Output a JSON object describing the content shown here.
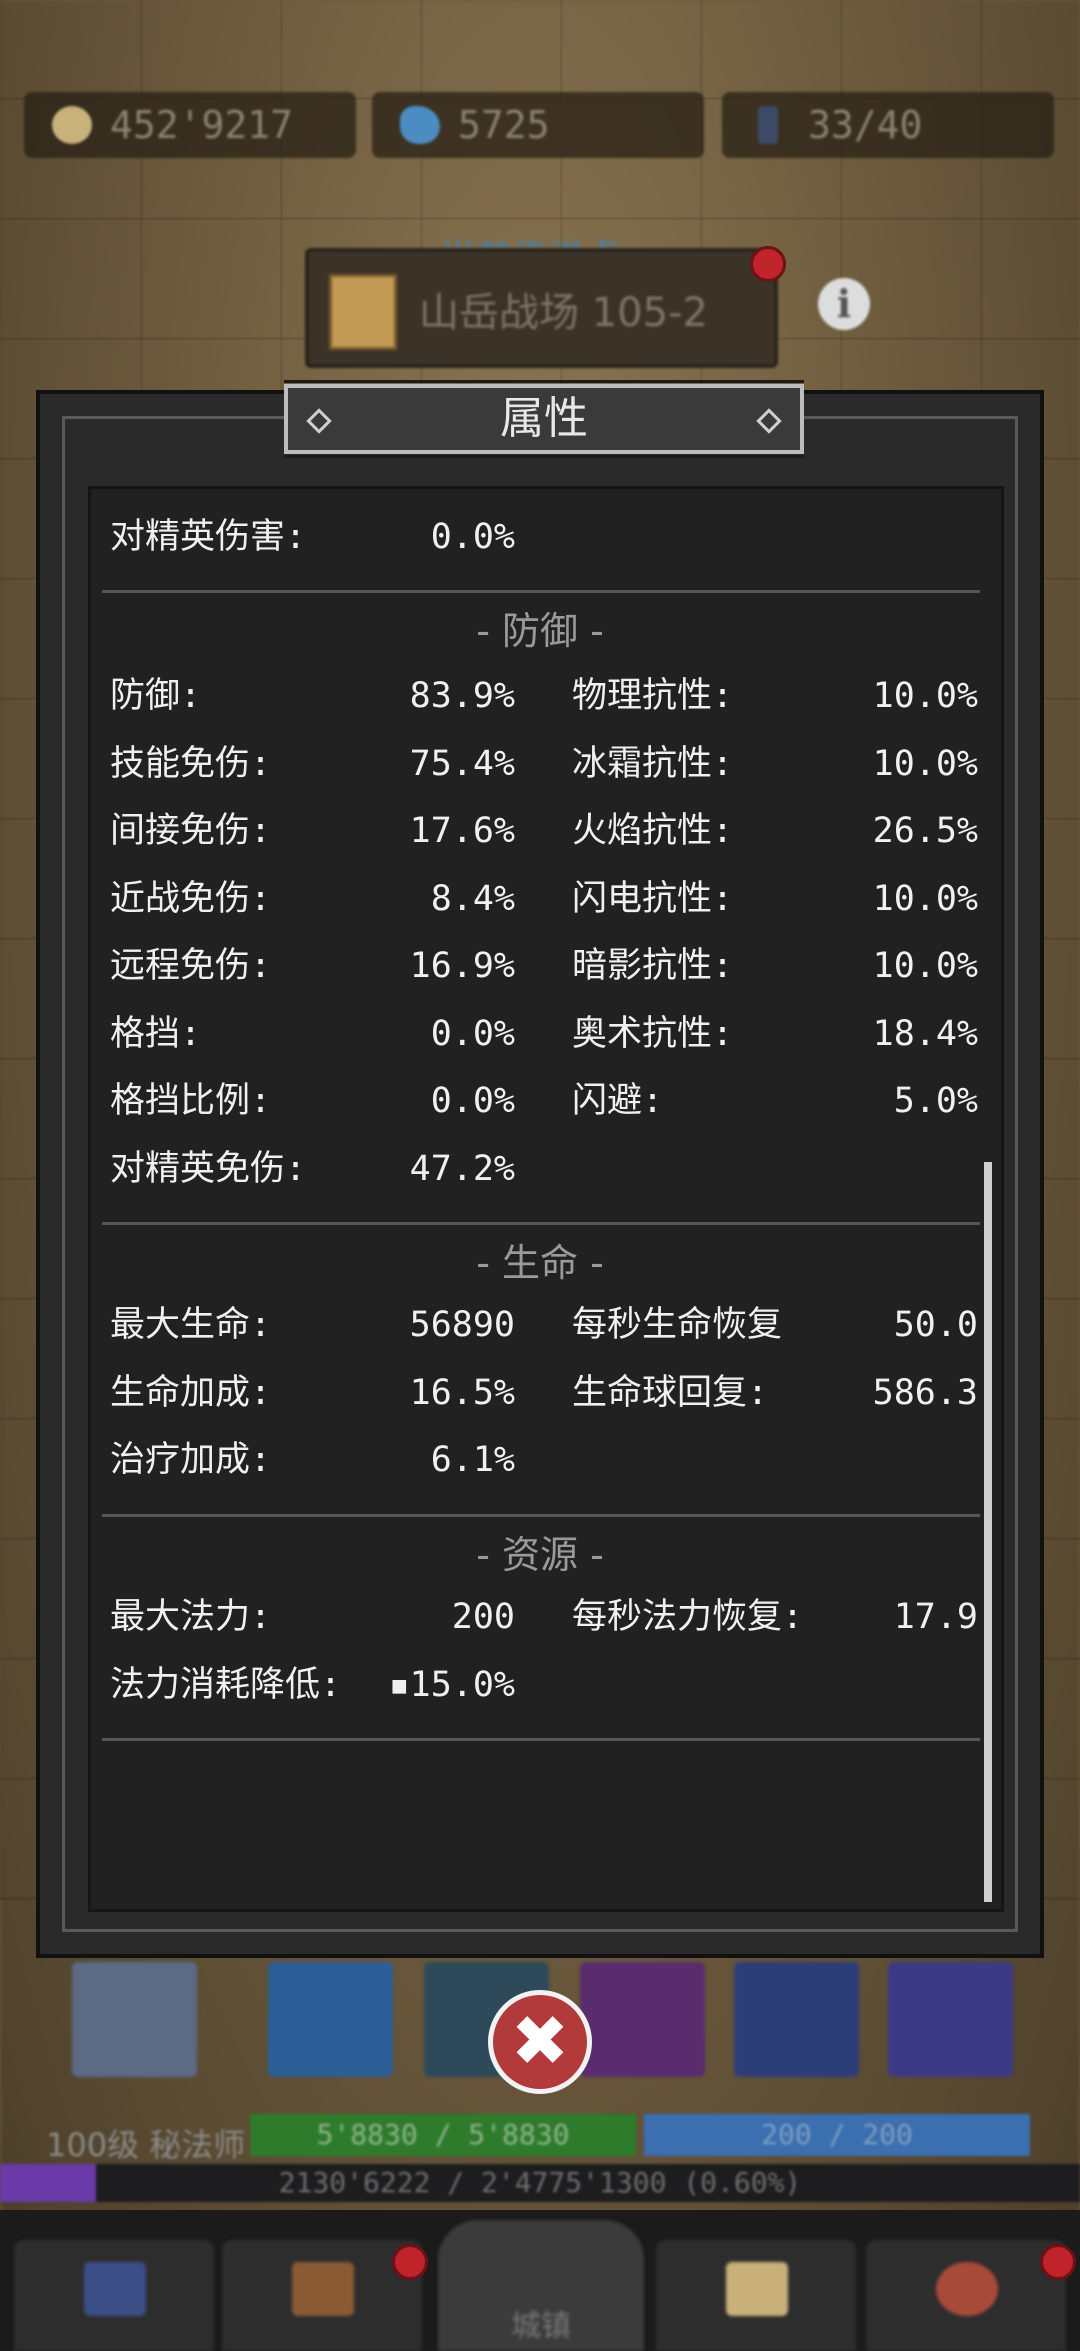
{
  "top_bar": {
    "gold": "452'9217",
    "gems": "5725",
    "keys": "33/40"
  },
  "teleport": {
    "label": "当前传送点",
    "name": "山岳战场 105-2"
  },
  "dialog": {
    "title": "属性",
    "top_rows": [
      {
        "label": "对精英伤害:",
        "value": "0.0%"
      }
    ],
    "sections": [
      {
        "title": "- 防御 -",
        "rows": [
          {
            "left_label": "防御:",
            "left_value": "83.9%",
            "right_label": "物理抗性:",
            "right_value": "10.0%"
          },
          {
            "left_label": "技能免伤:",
            "left_value": "75.4%",
            "right_label": "冰霜抗性:",
            "right_value": "10.0%"
          },
          {
            "left_label": "间接免伤:",
            "left_value": "17.6%",
            "right_label": "火焰抗性:",
            "right_value": "26.5%"
          },
          {
            "left_label": "近战免伤:",
            "left_value": "8.4%",
            "right_label": "闪电抗性:",
            "right_value": "10.0%"
          },
          {
            "left_label": "远程免伤:",
            "left_value": "16.9%",
            "right_label": "暗影抗性:",
            "right_value": "10.0%"
          },
          {
            "left_label": "格挡:",
            "left_value": "0.0%",
            "right_label": "奥术抗性:",
            "right_value": "18.4%"
          },
          {
            "left_label": "格挡比例:",
            "left_value": "0.0%",
            "right_label": "闪避:",
            "right_value": "5.0%"
          },
          {
            "left_label": "对精英免伤:",
            "left_value": "47.2%",
            "right_label": "",
            "right_value": ""
          }
        ]
      },
      {
        "title": "- 生命 -",
        "rows": [
          {
            "left_label": "最大生命:",
            "left_value": "56890",
            "right_label": "每秒生命恢复",
            "right_value": "50.0"
          },
          {
            "left_label": "生命加成:",
            "left_value": "16.5%",
            "right_label": "生命球回复:",
            "right_value": "586.3"
          },
          {
            "left_label": "治疗加成:",
            "left_value": "6.1%",
            "right_label": "",
            "right_value": ""
          }
        ]
      },
      {
        "title": "- 资源 -",
        "rows": [
          {
            "left_label": "最大法力:",
            "left_value": "200",
            "right_label": "每秒法力恢复:",
            "right_value": "17.9"
          },
          {
            "left_label": "法力消耗降低:",
            "left_value": "▪15.0%",
            "right_label": "",
            "right_value": ""
          }
        ]
      }
    ]
  },
  "player": {
    "level_class": "100级 秘法师",
    "hp": "5'8830 / 5'8830",
    "mp": "200 / 200",
    "xp": "2130'6222 / 2'4775'1300 (0.60%)",
    "xp_fraction": 0.0088
  },
  "nav": {
    "home_label": "城镇"
  },
  "colors": {
    "panel": "#2a2a2a",
    "text": "#f0f0f0",
    "section": "#9a9a9a",
    "close_red": "#b23a3a"
  },
  "icons": [
    "gold-coin-icon",
    "gem-icon",
    "key-icon",
    "map-book-icon",
    "info-icon",
    "close-icon"
  ]
}
